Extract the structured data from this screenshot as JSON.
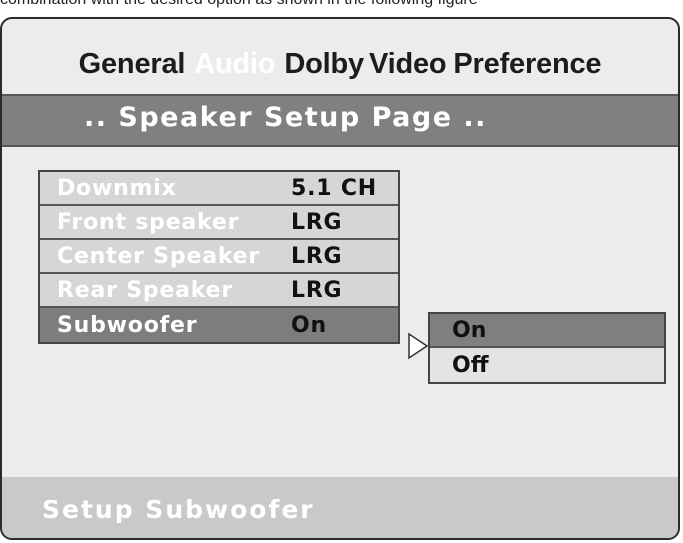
{
  "caption": "combination with the desired option as shown in the following figure",
  "tabs": [
    {
      "label": "General",
      "active": false
    },
    {
      "label": "Audio",
      "active": true
    },
    {
      "label": "Dolby",
      "active": false
    },
    {
      "label": "Video",
      "active": false
    },
    {
      "label": "Preference",
      "active": false
    }
  ],
  "page_title": ".. Speaker Setup Page ..",
  "menu": [
    {
      "label": "Downmix",
      "value": "5.1 CH"
    },
    {
      "label": "Front speaker",
      "value": "LRG"
    },
    {
      "label": "Center Speaker",
      "value": "LRG"
    },
    {
      "label": "Rear Speaker",
      "value": "LRG"
    },
    {
      "label": "Subwoofer",
      "value": "On"
    }
  ],
  "submenu_options": [
    "On",
    "Off"
  ],
  "status": "Setup Subwoofer",
  "colors": {
    "bar_gray": "#808080",
    "selected_gray": "#7d7d7d",
    "panel_bg": "#ececec",
    "status_bg": "#c9c9c9"
  }
}
